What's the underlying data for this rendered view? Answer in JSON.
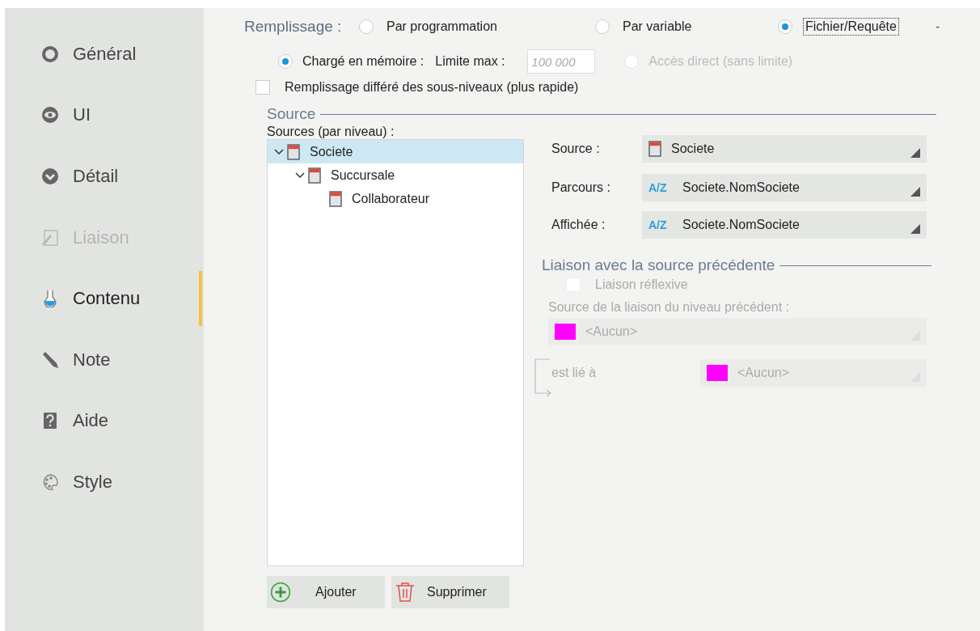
{
  "sidebar": {
    "items": [
      {
        "label": "Général",
        "selected": false,
        "disabled": false
      },
      {
        "label": "UI",
        "selected": false,
        "disabled": false
      },
      {
        "label": "Détail",
        "selected": false,
        "disabled": false
      },
      {
        "label": "Liaison",
        "selected": false,
        "disabled": true
      },
      {
        "label": "Contenu",
        "selected": true,
        "disabled": false
      },
      {
        "label": "Note",
        "selected": false,
        "disabled": false
      },
      {
        "label": "Aide",
        "selected": false,
        "disabled": false
      },
      {
        "label": "Style",
        "selected": false,
        "disabled": false
      }
    ]
  },
  "fill": {
    "label": "Remplissage :",
    "options": [
      {
        "label": "Par programmation",
        "selected": false,
        "focused": false
      },
      {
        "label": "Par variable",
        "selected": false,
        "focused": false
      },
      {
        "label": "Fichier/Requête",
        "selected": true,
        "focused": true
      }
    ],
    "trailing_mark": "-"
  },
  "load_modes": [
    {
      "label": "Chargé en mémoire :",
      "selected": true,
      "disabled": false
    },
    {
      "label": "Accès direct (sans limite)",
      "selected": false,
      "disabled": true
    }
  ],
  "limit": {
    "label": "Limite max :",
    "placeholder": "100 000"
  },
  "deferred": {
    "label": "Remplissage différé des sous-niveaux (plus rapide)",
    "checked": false
  },
  "source_group": {
    "title": "Source",
    "tree_label": "Sources (par niveau) :",
    "tree": [
      {
        "label": "Societe",
        "selected": true,
        "expanded": true,
        "children": [
          {
            "label": "Succursale",
            "selected": false,
            "expanded": true,
            "children": [
              {
                "label": "Collaborateur",
                "selected": false
              }
            ]
          }
        ]
      }
    ],
    "buttons": [
      {
        "label": "Ajouter",
        "kind": "add"
      },
      {
        "label": "Supprimer",
        "kind": "delete"
      }
    ],
    "properties": [
      {
        "label": "Source :",
        "kind": "table",
        "value": "Societe"
      },
      {
        "label": "Parcours :",
        "kind": "sort",
        "badge": "A/Z",
        "value": "Societe.NomSociete"
      },
      {
        "label": "Affichée :",
        "kind": "sort",
        "badge": "A/Z",
        "value": "Societe.NomSociete"
      }
    ]
  },
  "link_group": {
    "title": "Liaison avec la source précédente",
    "disabled": true,
    "reflexive": {
      "label": "Liaison réflexive",
      "checked": false
    },
    "prev_source": {
      "label": "Source de la liaison du niveau précédent :",
      "value": "<Aucun>",
      "color": "#ff00ff"
    },
    "linked_to": {
      "label": "est lié à",
      "value": "<Aucun>",
      "color": "#ff00ff"
    }
  }
}
